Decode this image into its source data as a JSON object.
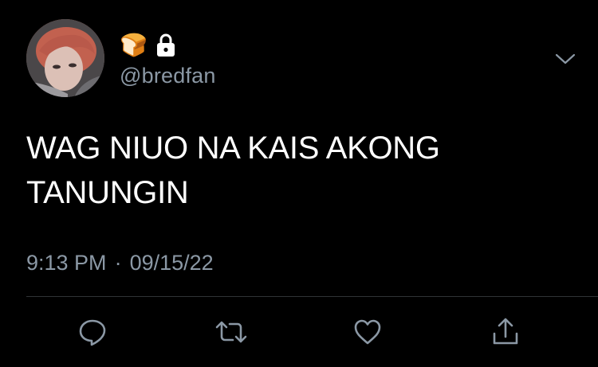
{
  "user": {
    "emoji": "🍞",
    "handle": "@bredfan",
    "protected": true
  },
  "tweet": {
    "text_lines": [
      "WAG NIUO NA KAIS AKONG",
      "TANUNGIN"
    ],
    "time": "9:13 PM",
    "separator": "·",
    "date": "09/15/22"
  },
  "actions": {
    "icons": [
      "reply-icon",
      "retweet-icon",
      "like-icon",
      "share-icon"
    ]
  },
  "colors": {
    "background": "#000000",
    "text": "#ffffff",
    "secondary_text": "#8b98a5",
    "divider": "#2f3336"
  }
}
